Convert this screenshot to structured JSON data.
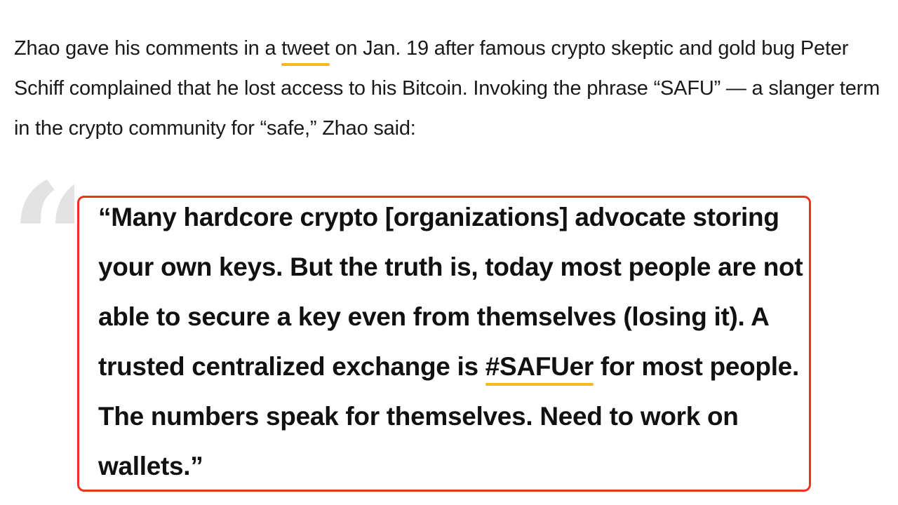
{
  "article": {
    "intro": {
      "part_1": "Zhao gave his comments in a ",
      "link_text": "tweet",
      "part_2": " on Jan. 19 after famous crypto skeptic and gold bug Peter Schiff complained that he lost access to his Bitcoin. Invoking the phrase “SAFU” — a slanger term in the crypto community for “safe,” Zhao said:"
    },
    "blockquote": {
      "quote_glyph": "“",
      "part_1": "“Many hardcore crypto [organizations] advocate storing your own keys. But the truth is, today most people are not able to secure a key even from themselves (losing it). A trusted centralized exchange is ",
      "hashtag": "#SAFUer",
      "part_2": " for most people. The numbers speak for themselves. Need to work on wallets.”"
    }
  },
  "colors": {
    "link_underline": "#f3b824",
    "highlight_border": "#ea3323",
    "quote_glyph": "#e3e3e3",
    "text": "#1a1a1a"
  }
}
